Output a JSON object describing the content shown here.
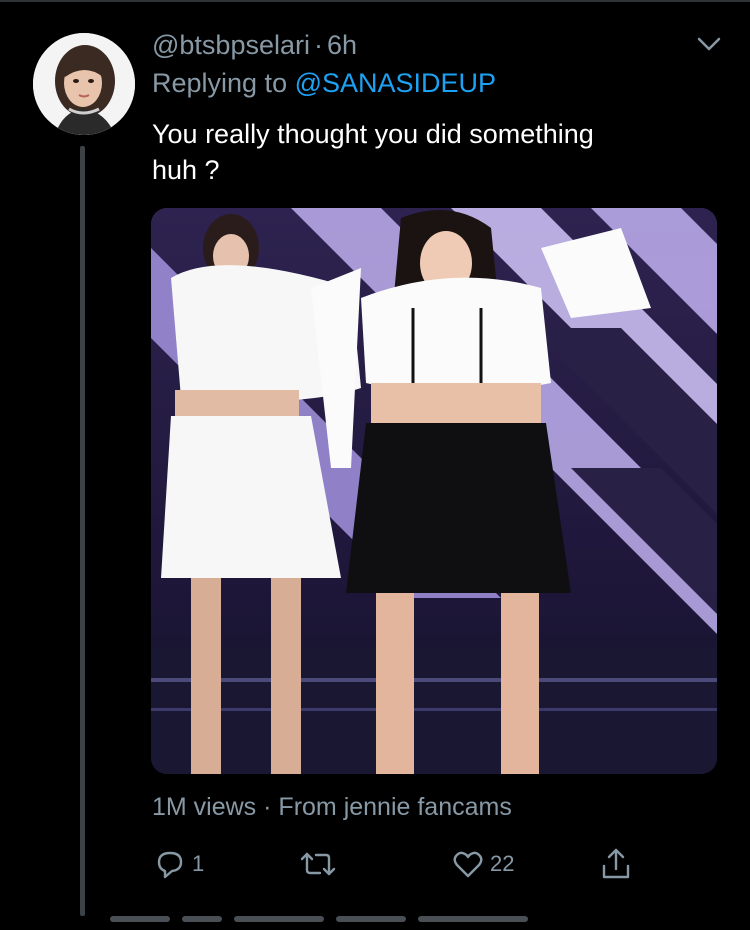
{
  "tweet": {
    "handle": "@btsbpselari",
    "separator": "·",
    "time": "6h",
    "replying_prefix": "Replying to",
    "replying_to": "@SANASIDEUP",
    "text_line1": "You really thought you did something",
    "text_line2": "huh ?",
    "media_views": "1M views",
    "media_source": "From jennie fancams"
  },
  "actions": {
    "reply_count": "1",
    "retweet_count": "",
    "like_count": "22"
  },
  "icons": {
    "avatar": "profile-photo",
    "chevron": "chevron-down-icon",
    "reply": "reply-icon",
    "retweet": "retweet-icon",
    "like": "heart-icon",
    "share": "share-icon"
  },
  "colors": {
    "background": "#000000",
    "muted_text": "#8899a6",
    "mention": "#1da1f2",
    "text": "#ffffff"
  }
}
